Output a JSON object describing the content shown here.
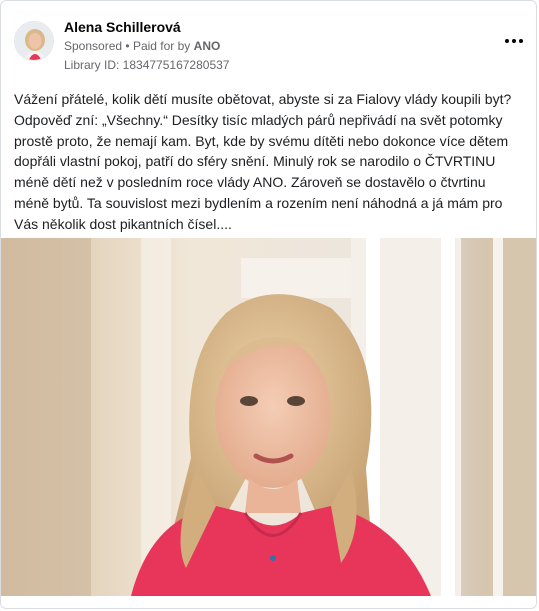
{
  "post": {
    "author": "Alena Schillerová",
    "sponsored_label": "Sponsored",
    "separator": "•",
    "paid_for_prefix": "Paid for by",
    "paid_for_by": "ANO",
    "library_id": "Library ID: 1834775167280537",
    "body": "Vážení přátelé, kolik dětí musíte obětovat, abyste si za Fialovy vlády koupili byt? Odpověď zní: „Všechny.“ Desítky tisíc mladých párů nepřivádí na svět potomky prostě proto, že nemají kam. Byt, kde by svému dítěti nebo dokonce více dětem dopřáli vlastní pokoj, patří do sféry snění. Minulý rok se narodilo o ČTVRTINU méně dětí než v posledním roce vlády ANO. Zároveň se dostavělo o čtvrtinu méně bytů. Ta souvislost mezi bydlením a rozením není náhodná a já mám pro Vás několik dost pikantních čísel...."
  },
  "icons": {
    "more": "more-options-icon",
    "avatar": "profile-photo"
  },
  "colors": {
    "text_primary": "#050505",
    "text_secondary": "#65676b",
    "border": "#dadde1",
    "blouse": "#e8365b",
    "hair": "#d9b98a"
  }
}
